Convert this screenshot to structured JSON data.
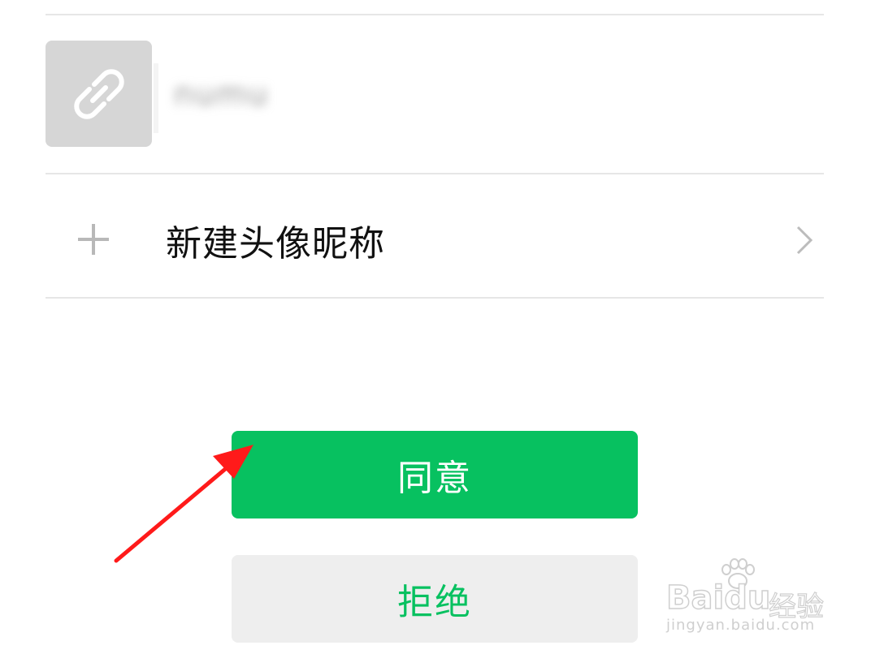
{
  "profile": {
    "nickname": "numu",
    "avatar_icon": "link-icon"
  },
  "new_profile": {
    "label": "新建头像昵称",
    "icon": "plus-icon",
    "chevron_icon": "chevron-right-icon"
  },
  "actions": {
    "agree_label": "同意",
    "reject_label": "拒绝"
  },
  "watermark": {
    "brand": "Baidu",
    "brand_cn": "经验",
    "url": "jingyan.baidu.com"
  },
  "colors": {
    "primary": "#07c160",
    "secondary_bg": "#eeeeee",
    "annotation_arrow": "#ff1a1a"
  }
}
